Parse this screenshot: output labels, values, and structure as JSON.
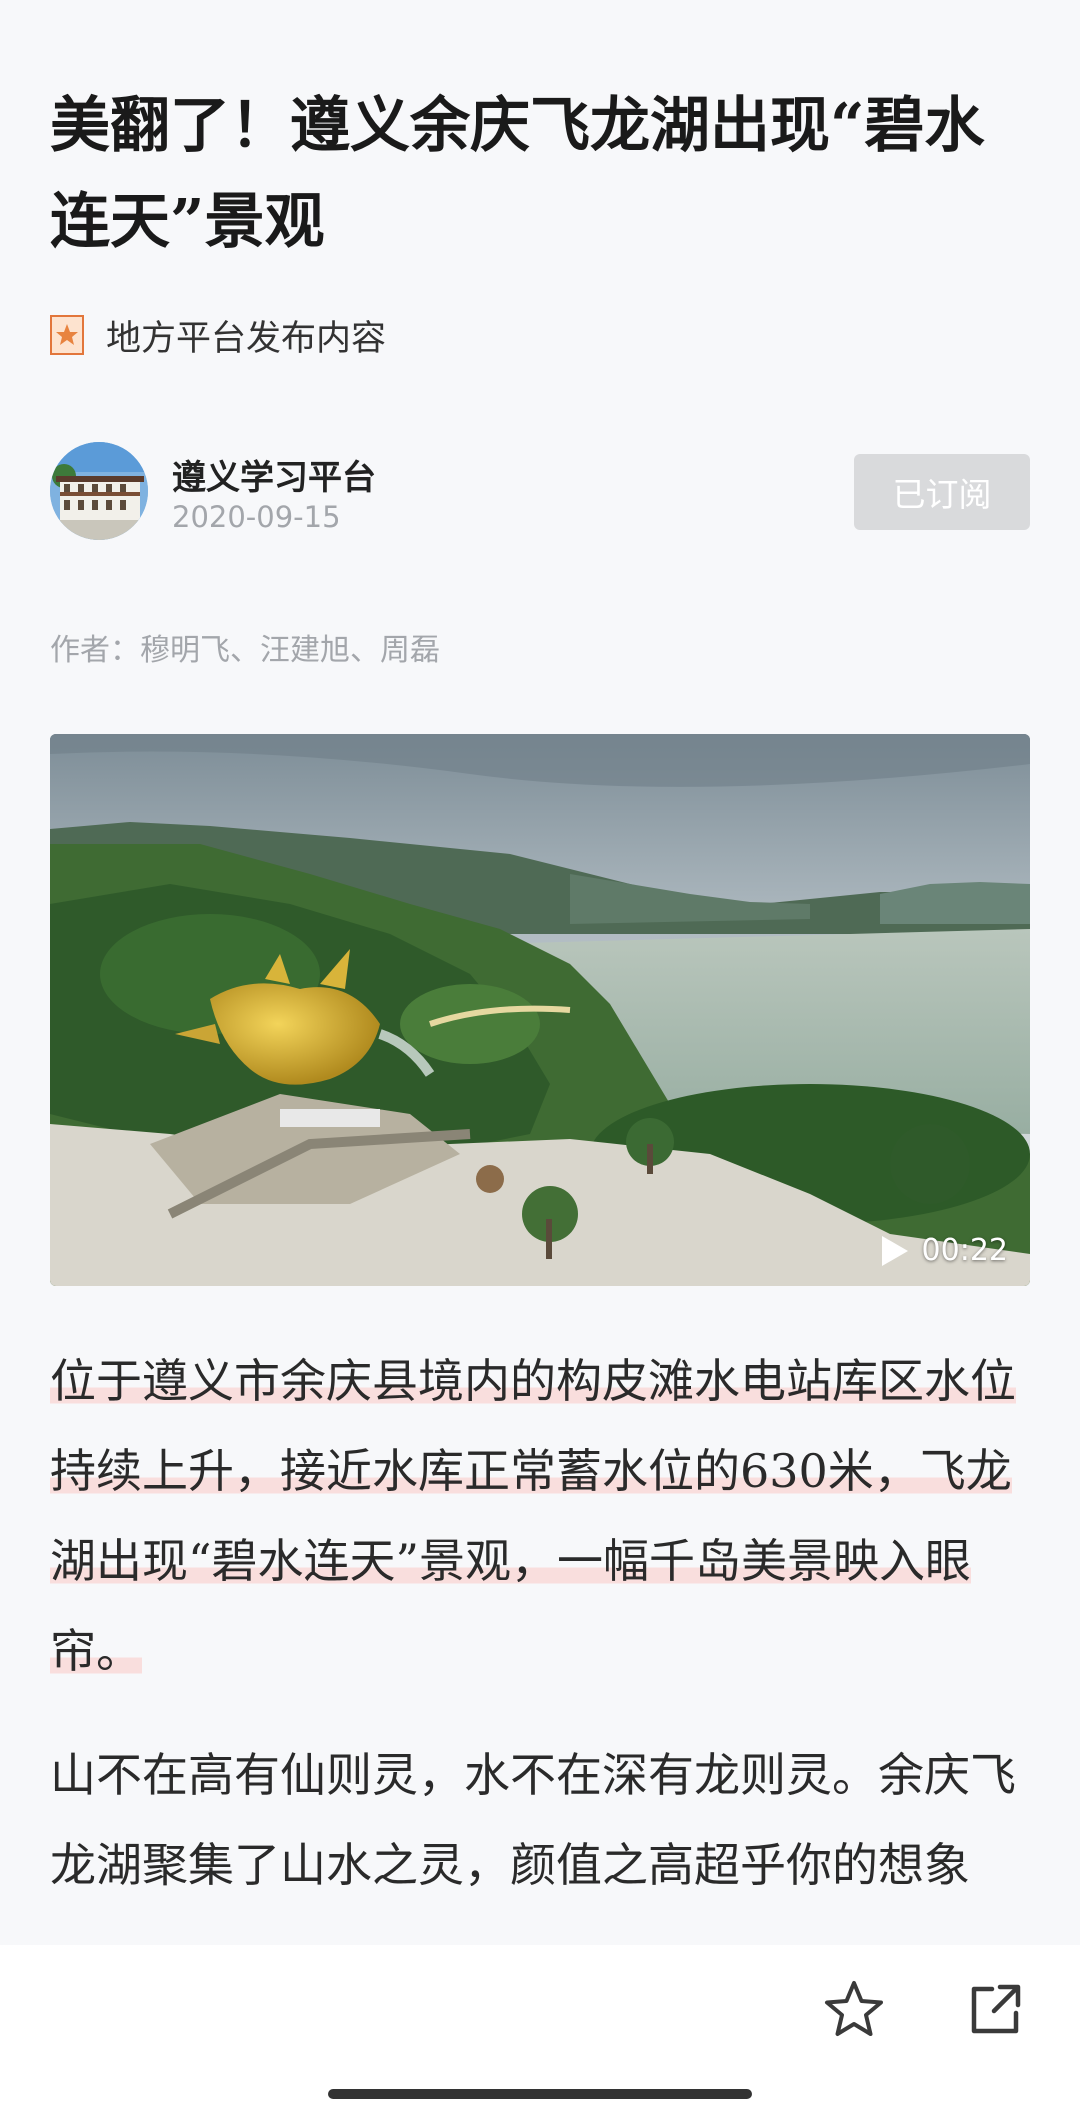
{
  "article": {
    "title": "美翻了！遵义余庆飞龙湖出现“碧水连天”景观",
    "source_badge_icon": "star-badge-icon",
    "source_label": "地方平台发布内容",
    "account": {
      "name": "遵义学习平台",
      "date": "2020-09-15",
      "subscribe_label": "已订阅"
    },
    "byline": "作者：穆明飞、汪建旭、周磊",
    "video": {
      "duration": "00:22",
      "play_icon": "play-icon"
    },
    "paragraphs": [
      "位于遵义市余庆县境内的构皮滩水电站库区水位持续上升，接近水库正常蓄水位的630米，飞龙湖出现“碧水连天”景观，一幅千岛美景映入眼帘。",
      "山不在高有仙则灵，水不在深有龙则灵。余庆飞龙湖聚集了山水之灵，颜值之高超乎你的想象"
    ]
  },
  "bottom_bar": {
    "favorite_icon": "star-outline-icon",
    "share_icon": "share-icon"
  },
  "colors": {
    "background": "#f7f8fa",
    "highlight": "#f9dedd",
    "subscribed_button": "#d9dadc",
    "muted_text": "#a3a6ab"
  }
}
